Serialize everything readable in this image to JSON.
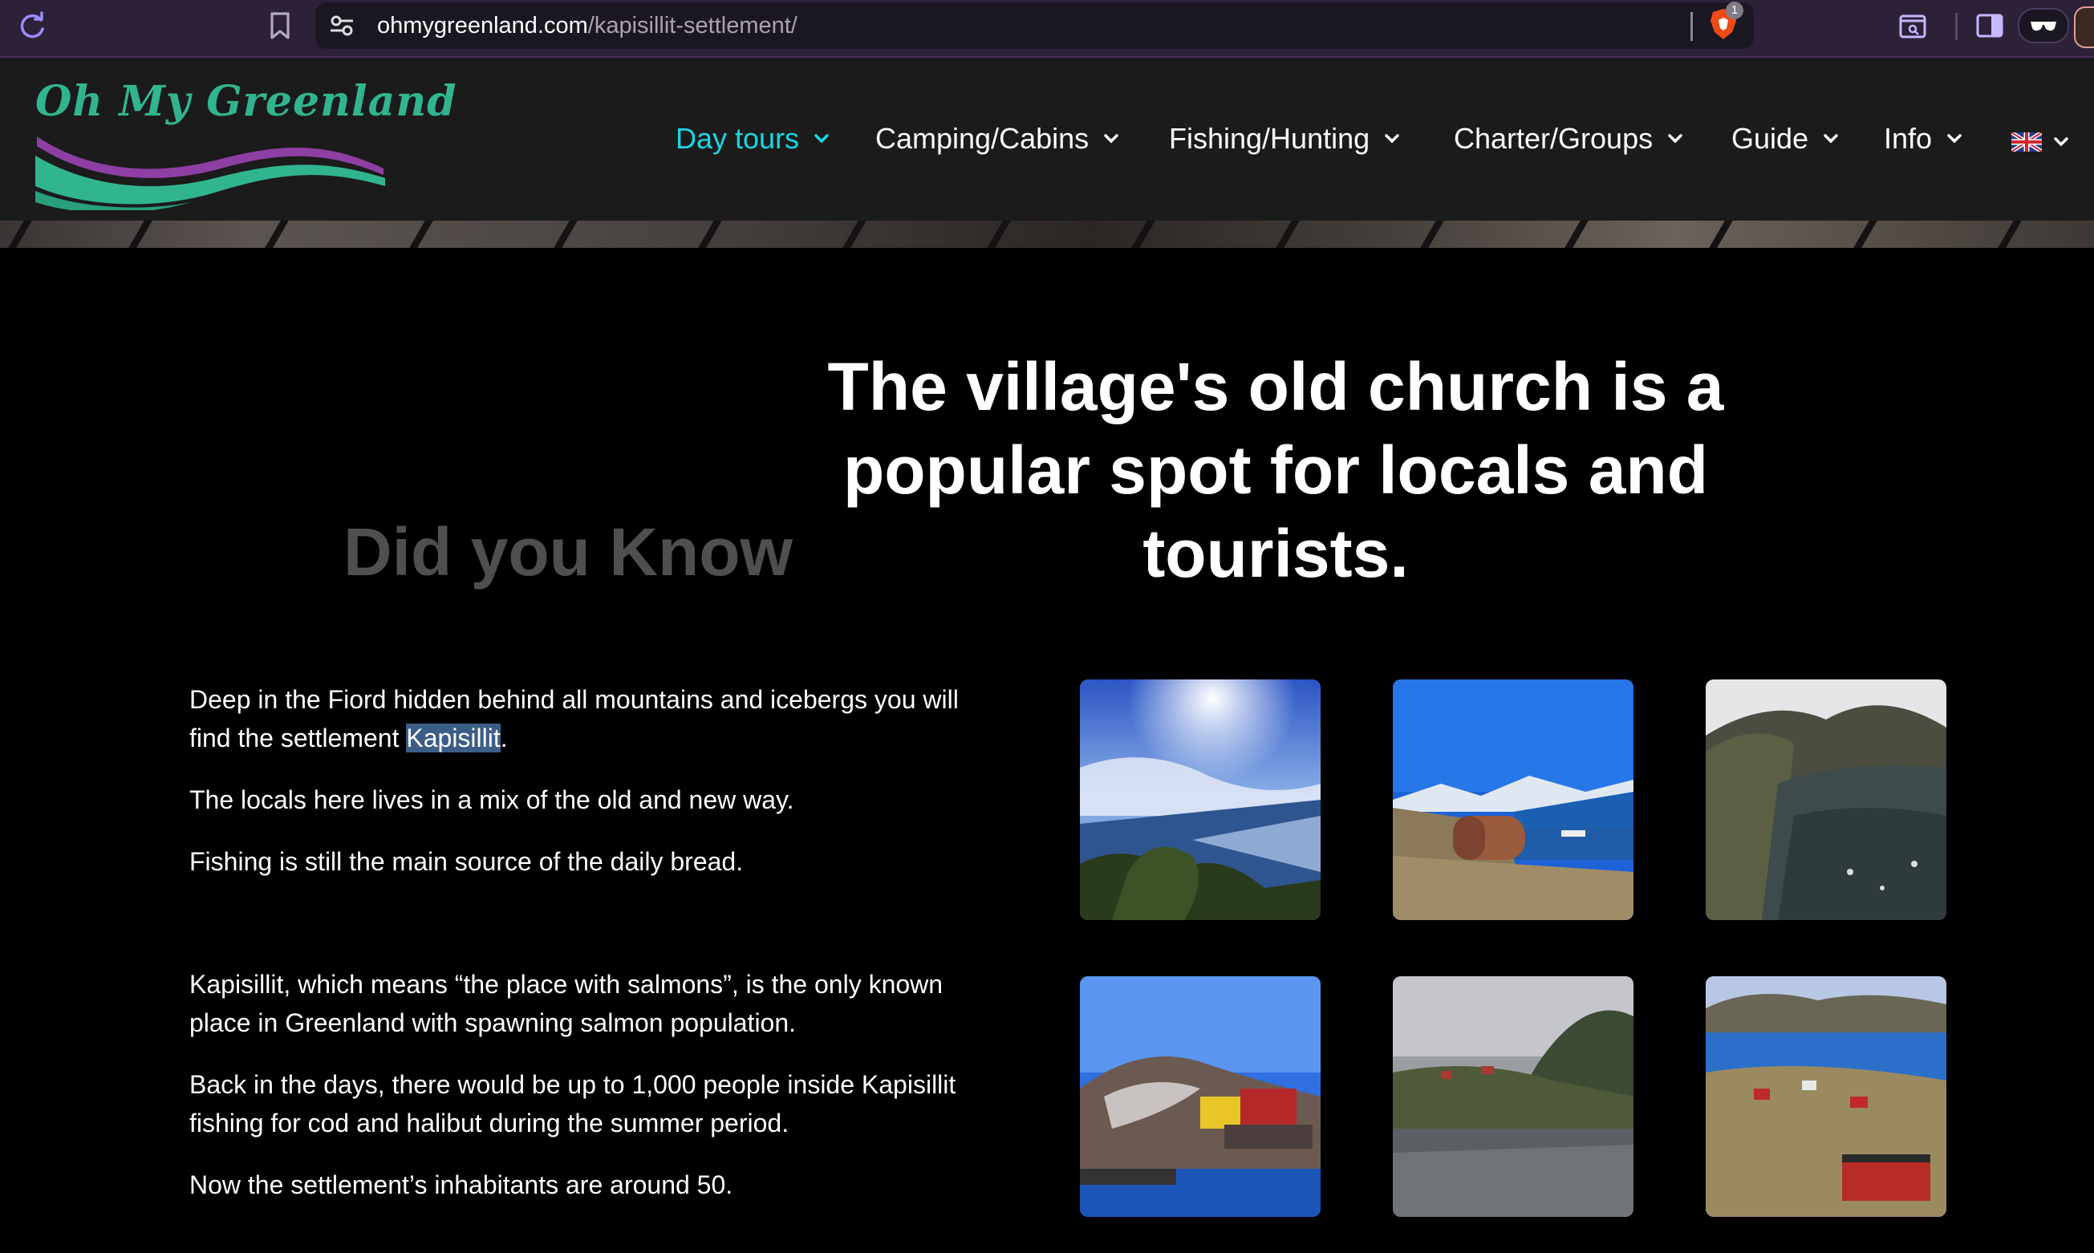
{
  "browser": {
    "url_domain": "ohmygreenland.com",
    "url_path": "/kapisillit-settlement/",
    "extension_badge": "1"
  },
  "site": {
    "logo_text": "Oh My Greenland",
    "nav": [
      {
        "label": "Day tours"
      },
      {
        "label": "Camping/Cabins"
      },
      {
        "label": "Fishing/Hunting"
      },
      {
        "label": "Charter/Groups"
      },
      {
        "label": "Guide"
      },
      {
        "label": "Info"
      }
    ],
    "accent_color": "#17d6e4",
    "brand_green": "#31b58f",
    "brand_purple": "#8e3fa3"
  },
  "content": {
    "headline_line1": "The village's old church is a",
    "headline_line2": "popular spot for locals and",
    "headline_line3": "tourists.",
    "did_you_know": "Did you Know",
    "p1_before": "Deep in the Fiord hidden behind all mountains and icebergs you will find the settlement ",
    "p1_highlight": "Kapisillit",
    "p1_after": ".",
    "p2": "The locals here lives in a mix of the old and new way.",
    "p3": "Fishing is still the main source of the daily bread.",
    "p4": "Kapisillit, which means “the place with salmons”, is the only known place in Greenland with spawning salmon population.",
    "p5": "Back in the days, there would be up to 1,000 people inside Kapisillit fishing for cod and halibut during the summer period.",
    "p6": "Now the settlement’s inhabitants are around 50."
  }
}
